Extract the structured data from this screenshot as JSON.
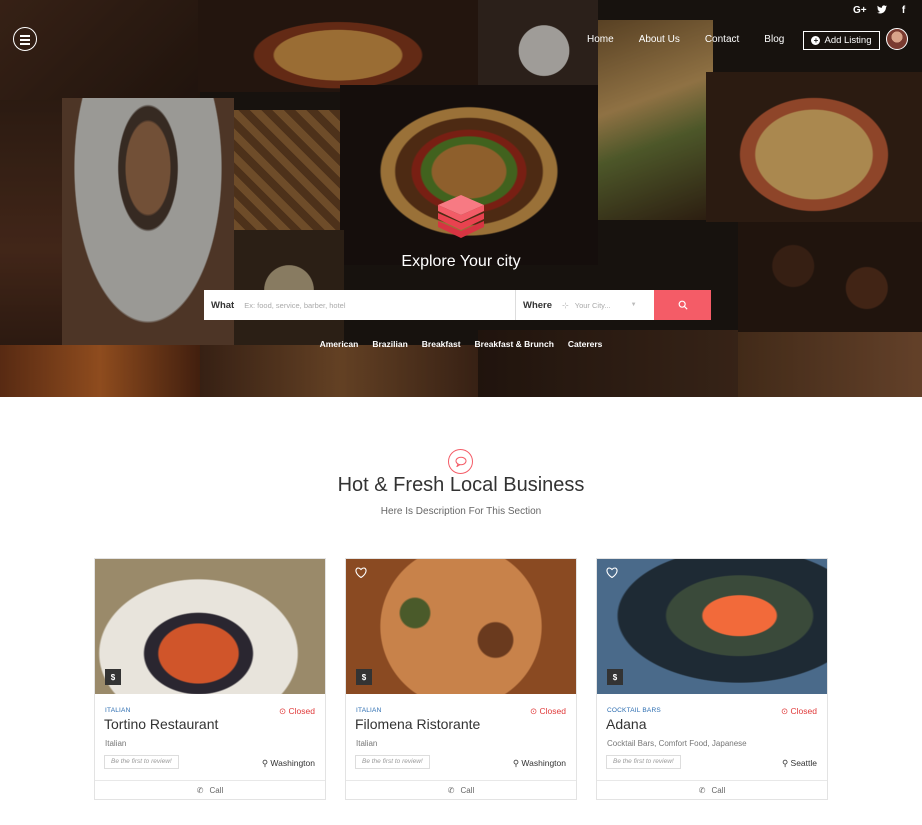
{
  "social": [
    "G+",
    "t",
    "f"
  ],
  "nav": {
    "items": [
      "Home",
      "About Us",
      "Contact",
      "Blog"
    ],
    "add_listing": "Add Listing"
  },
  "hero": {
    "title": "Explore Your city",
    "search": {
      "what_label": "What",
      "what_placeholder": "Ex: food, service, barber, hotel",
      "where_label": "Where",
      "where_placeholder": "Your City..."
    },
    "categories": [
      "American",
      "Brazilian",
      "Breakfast",
      "Breakfast & Brunch",
      "Caterers"
    ]
  },
  "section": {
    "title": "Hot & Fresh Local Business",
    "description": "Here Is Description For This Section"
  },
  "listings": [
    {
      "category": "Italian",
      "status": "Closed",
      "name": "Tortino Restaurant",
      "tags": "Italian",
      "review": "Be the first to review!",
      "location": "Washington",
      "price": "$",
      "call": "Call"
    },
    {
      "category": "Italian",
      "status": "Closed",
      "name": "Filomena Ristorante",
      "tags": "Italian",
      "review": "Be the first to review!",
      "location": "Washington",
      "price": "$",
      "call": "Call"
    },
    {
      "category": "Cocktail Bars",
      "status": "Closed",
      "name": "Adana",
      "tags": "Cocktail Bars, Comfort Food, Japanese",
      "review": "Be the first to review!",
      "location": "Seattle",
      "price": "$",
      "call": "Call"
    }
  ],
  "colors": {
    "accent": "#f45c67",
    "status_closed": "#e03a3a",
    "category_link": "#2b6cb0"
  }
}
